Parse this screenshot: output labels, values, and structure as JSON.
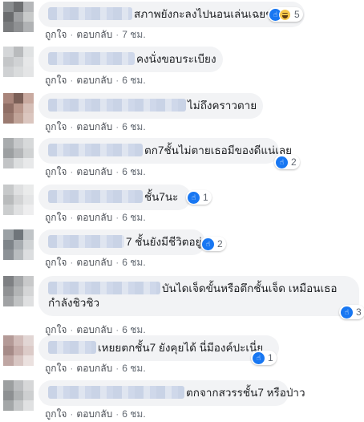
{
  "comments": [
    {
      "text": "สภาพยังกะลงไปนอนเล่นเฉยๆ !!",
      "like_label": "ถูกใจ",
      "reply_label": "ตอบกลับ",
      "time": "7 ชม.",
      "reactions": [
        "like-icon",
        "haha-icon"
      ],
      "reaction_count": "5"
    },
    {
      "text": "คงนั่งขอบระเบียง",
      "like_label": "ถูกใจ",
      "reply_label": "ตอบกลับ",
      "time": "6 ชม.",
      "reactions": [],
      "reaction_count": ""
    },
    {
      "text": "ไม่ถึงคราวตาย",
      "like_label": "ถูกใจ",
      "reply_label": "ตอบกลับ",
      "time": "6 ชม.",
      "reactions": [],
      "reaction_count": ""
    },
    {
      "text": "ตก7ชั้นไม่ตายเธอมีของดีแน่เลย",
      "like_label": "ถูกใจ",
      "reply_label": "ตอบกลับ",
      "time": "6 ชม.",
      "reactions": [
        "like-icon"
      ],
      "reaction_count": "2"
    },
    {
      "text": "ชั้น7นะ",
      "like_label": "ถูกใจ",
      "reply_label": "ตอบกลับ",
      "time": "6 ชม.",
      "reactions": [
        "like-icon"
      ],
      "reaction_count": "1"
    },
    {
      "text": "7 ชั้นยังมีชีวิตอยู่",
      "like_label": "ถูกใจ",
      "reply_label": "ตอบกลับ",
      "time": "6 ชม.",
      "reactions": [
        "like-icon"
      ],
      "reaction_count": "2"
    },
    {
      "text": "บันไดเจ็ดขั้นหรือตึกชั้นเจ็ด เหมือนเธอกำลังชิวชิว",
      "like_label": "ถูกใจ",
      "reply_label": "ตอบกลับ",
      "time": "6 ชม.",
      "reactions": [
        "like-icon"
      ],
      "reaction_count": "3"
    },
    {
      "text": "เหยยตกชั้น7 ยังคุยได้ นี่มีองค์ปะเนี่ย",
      "like_label": "ถูกใจ",
      "reply_label": "ตอบกลับ",
      "time": "6 ชม.",
      "reactions": [
        "like-icon"
      ],
      "reaction_count": "1"
    },
    {
      "text": "ตกจากสวรรชั้น7 หรือป่าว",
      "like_label": "ถูกใจ",
      "reply_label": "ตอบกลับ",
      "time": "6 ชม.",
      "reactions": [],
      "reaction_count": ""
    }
  ],
  "colors": {
    "like": "#1877f2",
    "bubble": "#f2f3f5",
    "meta": "#606770"
  }
}
